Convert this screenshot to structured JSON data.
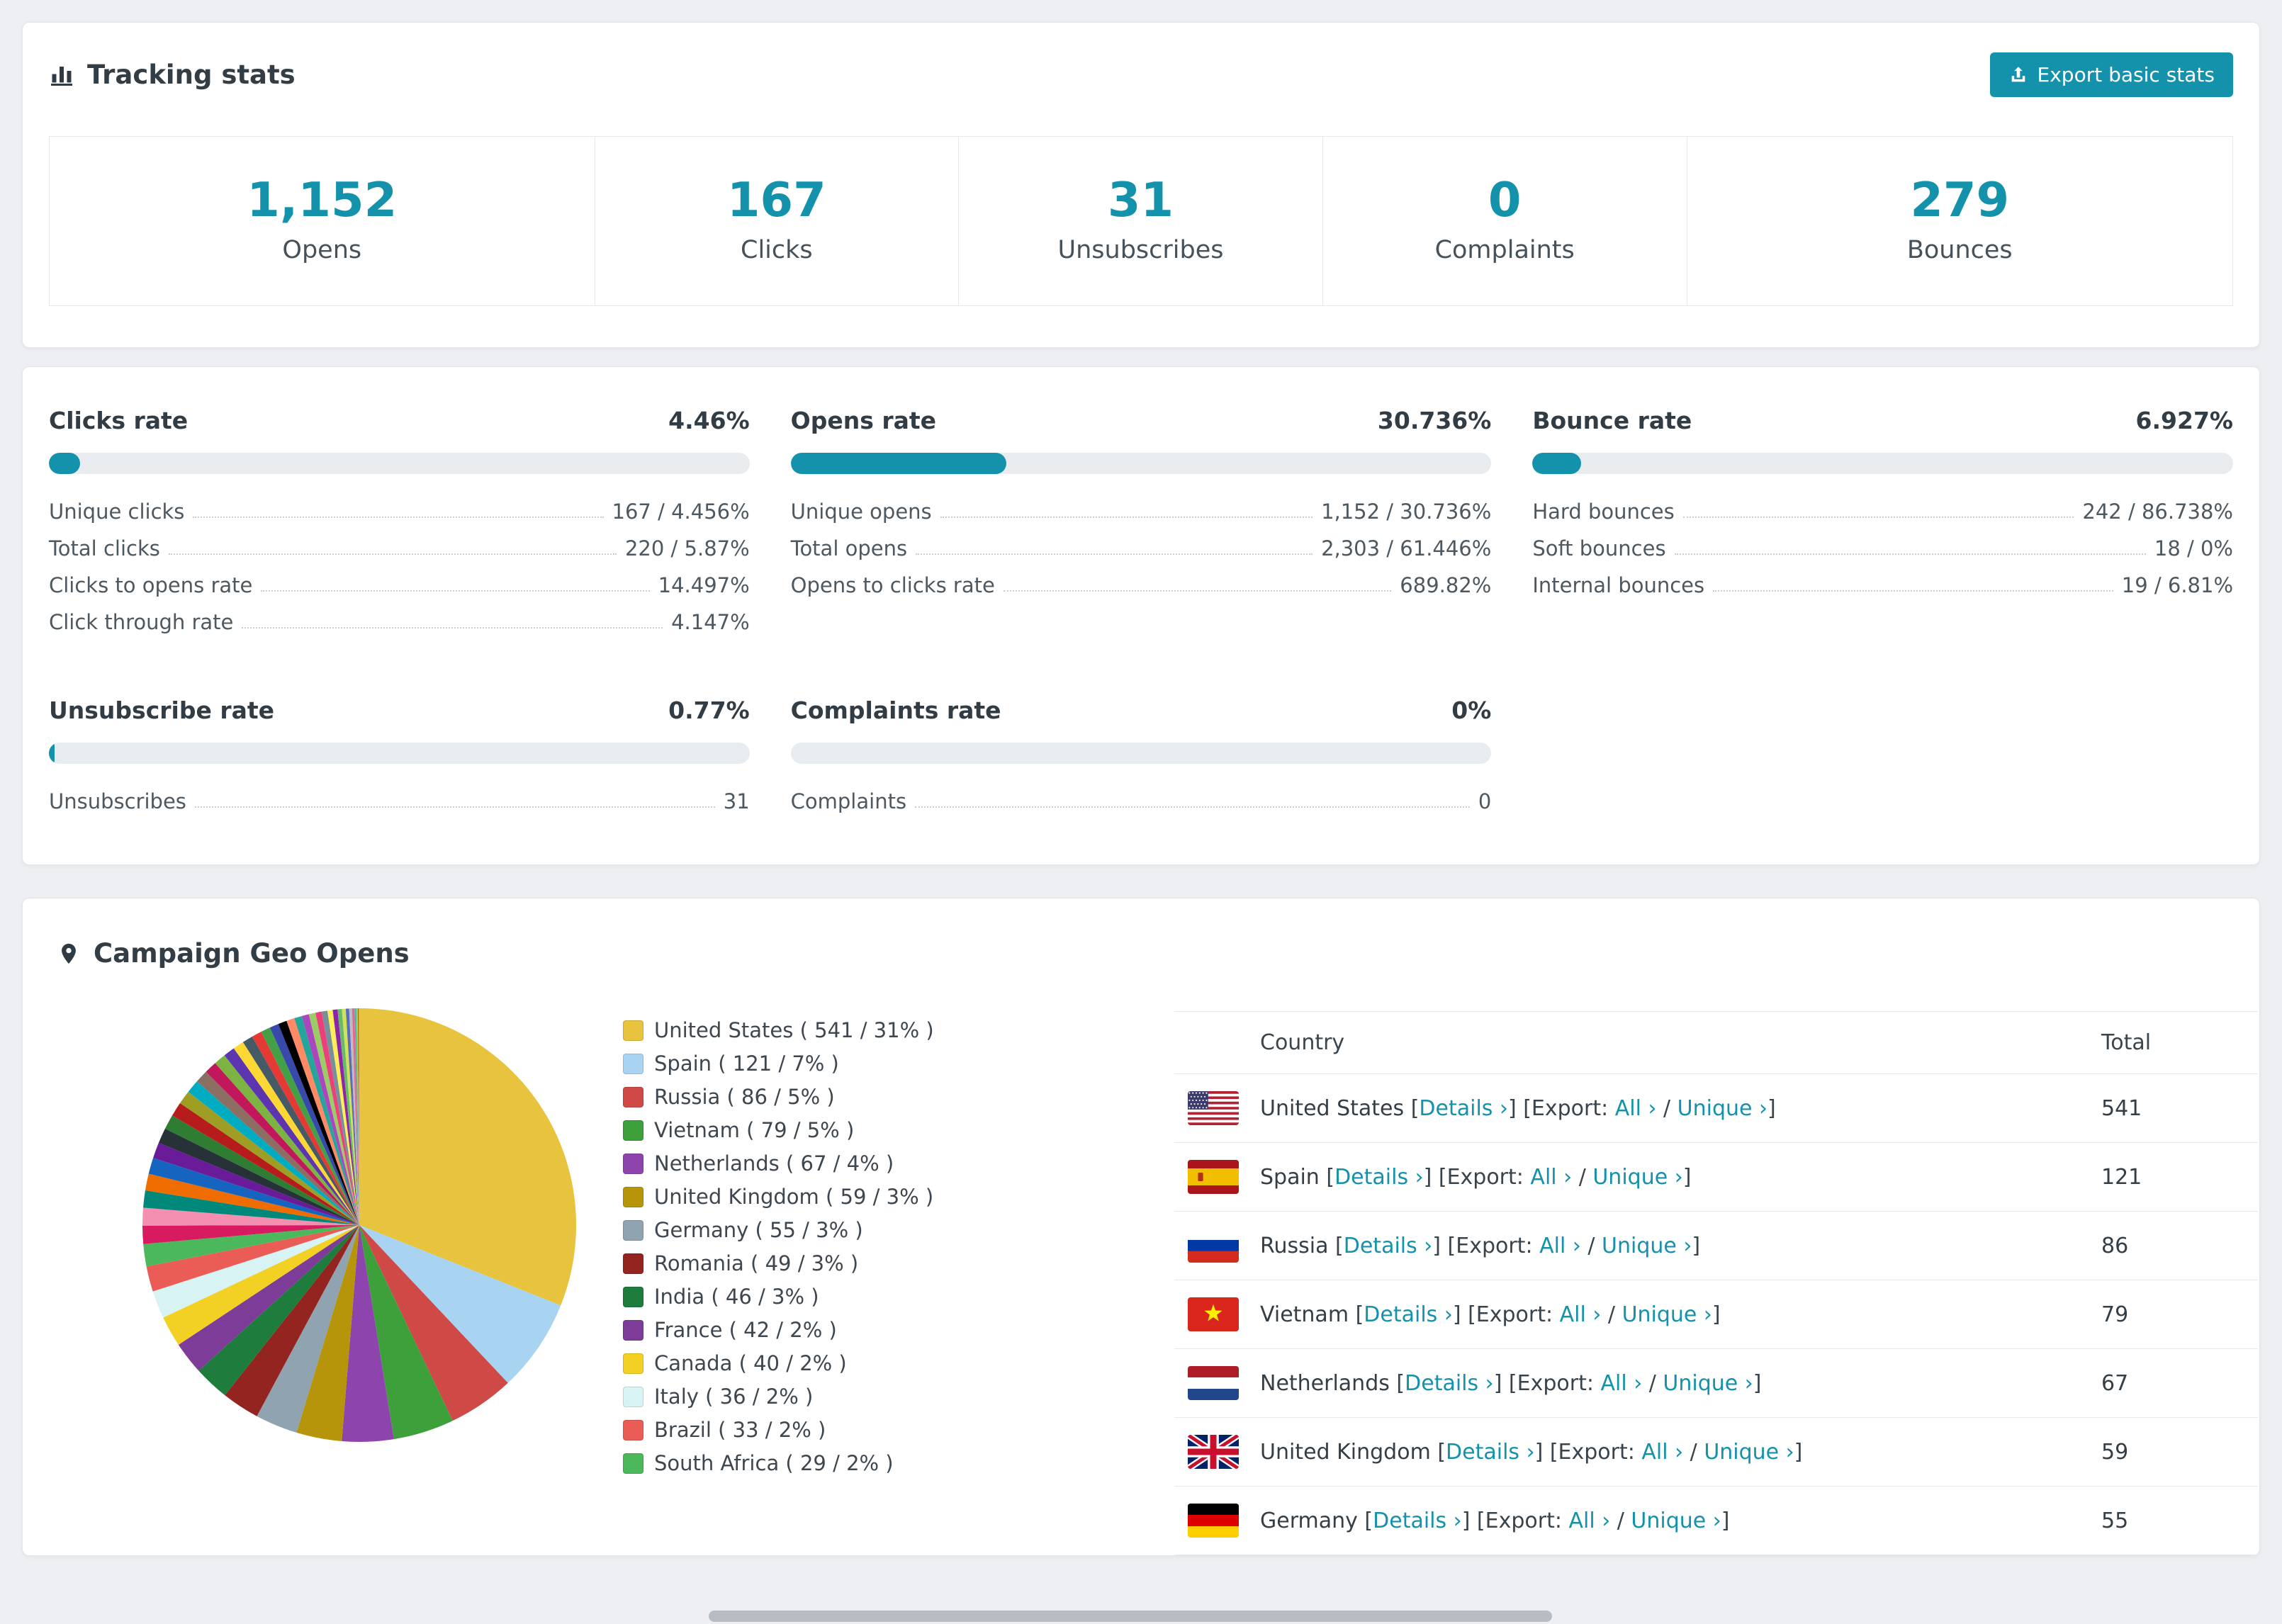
{
  "accent": "#1492ac",
  "tracking": {
    "title": "Tracking stats",
    "export_label": "Export basic stats",
    "stats": [
      {
        "value": "1,152",
        "label": "Opens"
      },
      {
        "value": "167",
        "label": "Clicks"
      },
      {
        "value": "31",
        "label": "Unsubscribes"
      },
      {
        "value": "0",
        "label": "Complaints"
      },
      {
        "value": "279",
        "label": "Bounces"
      }
    ]
  },
  "rates": [
    {
      "title": "Clicks rate",
      "percent": "4.46%",
      "bar": 4.46,
      "rows": [
        {
          "label": "Unique clicks",
          "value": "167 / 4.456%"
        },
        {
          "label": "Total clicks",
          "value": "220 / 5.87%"
        },
        {
          "label": "Clicks to opens rate",
          "value": "14.497%"
        },
        {
          "label": "Click through rate",
          "value": "4.147%"
        }
      ]
    },
    {
      "title": "Opens rate",
      "percent": "30.736%",
      "bar": 30.736,
      "rows": [
        {
          "label": "Unique opens",
          "value": "1,152 / 30.736%"
        },
        {
          "label": "Total opens",
          "value": "2,303 / 61.446%"
        },
        {
          "label": "Opens to clicks rate",
          "value": "689.82%"
        }
      ]
    },
    {
      "title": "Bounce rate",
      "percent": "6.927%",
      "bar": 6.927,
      "rows": [
        {
          "label": "Hard bounces",
          "value": "242 / 86.738%"
        },
        {
          "label": "Soft bounces",
          "value": "18 / 0%"
        },
        {
          "label": "Internal bounces",
          "value": "19 / 6.81%"
        }
      ]
    },
    {
      "title": "Unsubscribe rate",
      "percent": "0.77%",
      "bar": 0.77,
      "rows": [
        {
          "label": "Unsubscribes",
          "value": "31"
        }
      ]
    },
    {
      "title": "Complaints rate",
      "percent": "0%",
      "bar": 0,
      "rows": [
        {
          "label": "Complaints",
          "value": "0"
        }
      ]
    }
  ],
  "geo": {
    "title": "Campaign Geo Opens",
    "table": {
      "header": {
        "country": "Country",
        "total": "Total"
      },
      "labels": {
        "open": "[",
        "details": "Details ›",
        "close_open_export": "] [Export:",
        "all": "All ›",
        "separator": "/",
        "unique": "Unique ›",
        "close": "]"
      },
      "rows": [
        {
          "country": "United States",
          "total": "541",
          "flag": "us"
        },
        {
          "country": "Spain",
          "total": "121",
          "flag": "es"
        },
        {
          "country": "Russia",
          "total": "86",
          "flag": "ru"
        },
        {
          "country": "Vietnam",
          "total": "79",
          "flag": "vn"
        },
        {
          "country": "Netherlands",
          "total": "67",
          "flag": "nl"
        },
        {
          "country": "United Kingdom",
          "total": "59",
          "flag": "gb"
        },
        {
          "country": "Germany",
          "total": "55",
          "flag": "de"
        }
      ]
    }
  },
  "chart_data": {
    "type": "pie",
    "title": "Campaign Geo Opens",
    "legend_position": "right",
    "slices": [
      {
        "label": "United States",
        "value": 541,
        "percent": 31,
        "color": "#e8c33d"
      },
      {
        "label": "Spain",
        "value": 121,
        "percent": 7,
        "color": "#a8d4f2"
      },
      {
        "label": "Russia",
        "value": 86,
        "percent": 5,
        "color": "#cf4a47"
      },
      {
        "label": "Vietnam",
        "value": 79,
        "percent": 5,
        "color": "#3da03b"
      },
      {
        "label": "Netherlands",
        "value": 67,
        "percent": 4,
        "color": "#8e44ad"
      },
      {
        "label": "United Kingdom",
        "value": 59,
        "percent": 3,
        "color": "#b7950b"
      },
      {
        "label": "Germany",
        "value": 55,
        "percent": 3,
        "color": "#8fa3b0"
      },
      {
        "label": "Romania",
        "value": 49,
        "percent": 3,
        "color": "#93241f"
      },
      {
        "label": "India",
        "value": 46,
        "percent": 3,
        "color": "#1e7d3c"
      },
      {
        "label": "France",
        "value": 42,
        "percent": 2,
        "color": "#7d3c98"
      },
      {
        "label": "Canada",
        "value": 40,
        "percent": 2,
        "color": "#f2d024"
      },
      {
        "label": "Italy",
        "value": 36,
        "percent": 2,
        "color": "#d8f3f4"
      },
      {
        "label": "Brazil",
        "value": 33,
        "percent": 2,
        "color": "#ea5d57"
      },
      {
        "label": "South Africa",
        "value": 29,
        "percent": 2,
        "color": "#4cb85c"
      }
    ],
    "others": {
      "estimated_total": 460,
      "slice_count": 38
    }
  }
}
